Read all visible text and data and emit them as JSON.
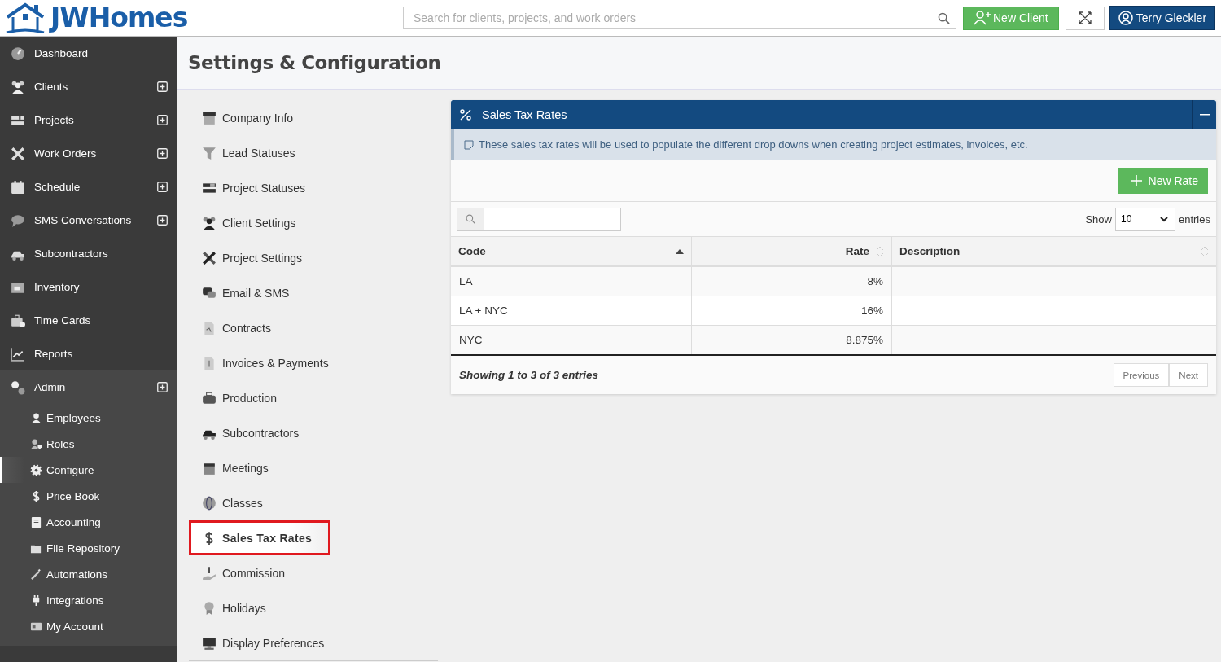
{
  "header": {
    "logo": "JWHomes",
    "search": {
      "placeholder": "Search for clients, projects, and work orders"
    },
    "new_client": "New Client",
    "user": "Terry Gleckler"
  },
  "sidebar": {
    "items": [
      {
        "label": "Dashboard",
        "expandable": false
      },
      {
        "label": "Clients",
        "expandable": true
      },
      {
        "label": "Projects",
        "expandable": true
      },
      {
        "label": "Work Orders",
        "expandable": true
      },
      {
        "label": "Schedule",
        "expandable": true
      },
      {
        "label": "SMS Conversations",
        "expandable": true
      },
      {
        "label": "Subcontractors",
        "expandable": false
      },
      {
        "label": "Inventory",
        "expandable": false
      },
      {
        "label": "Time Cards",
        "expandable": false
      },
      {
        "label": "Reports",
        "expandable": false
      },
      {
        "label": "Admin",
        "expandable": true,
        "expanded": true,
        "children": [
          {
            "label": "Employees",
            "selected": false
          },
          {
            "label": "Roles",
            "selected": false
          },
          {
            "label": "Configure",
            "selected": true
          },
          {
            "label": "Price Book",
            "selected": false
          },
          {
            "label": "Accounting",
            "selected": false
          },
          {
            "label": "File Repository",
            "selected": false
          },
          {
            "label": "Automations",
            "selected": false
          },
          {
            "label": "Integrations",
            "selected": false
          },
          {
            "label": "My Account",
            "selected": false
          }
        ]
      }
    ]
  },
  "page_title": "Settings & Configuration",
  "settings_menu": [
    {
      "label": "Company Info",
      "selected": false
    },
    {
      "label": "Lead Statuses",
      "selected": false
    },
    {
      "label": "Project Statuses",
      "selected": false
    },
    {
      "label": "Client Settings",
      "selected": false
    },
    {
      "label": "Project Settings",
      "selected": false
    },
    {
      "label": "Email & SMS",
      "selected": false
    },
    {
      "label": "Contracts",
      "selected": false
    },
    {
      "label": "Invoices & Payments",
      "selected": false
    },
    {
      "label": "Production",
      "selected": false
    },
    {
      "label": "Subcontractors",
      "selected": false
    },
    {
      "label": "Meetings",
      "selected": false
    },
    {
      "label": "Classes",
      "selected": false
    },
    {
      "label": "Sales Tax Rates",
      "selected": true,
      "annotated": true
    },
    {
      "label": "Commission",
      "selected": false
    },
    {
      "label": "Holidays",
      "selected": false
    },
    {
      "label": "Display Preferences",
      "selected": false
    }
  ],
  "panel": {
    "title": "Sales Tax Rates",
    "info": "These sales tax rates will be used to populate the different drop downs when creating project estimates, invoices, etc.",
    "new_button": "New Rate",
    "show_label": "Show",
    "page_size": "10",
    "entries_label": "entries",
    "columns": [
      {
        "label": "Code",
        "sorted": true,
        "right_aligned": false
      },
      {
        "label": "Rate",
        "sorted": false,
        "right_aligned": true
      },
      {
        "label": "Description",
        "sorted": false,
        "right_aligned": false
      }
    ],
    "rows": [
      [
        "LA",
        "8%",
        ""
      ],
      [
        "LA + NYC",
        "16%",
        ""
      ],
      [
        "NYC",
        "8.875%",
        ""
      ]
    ],
    "summary": "Showing 1 to 3 of 3 entries",
    "pagination": [
      "Previous",
      "Next"
    ]
  }
}
